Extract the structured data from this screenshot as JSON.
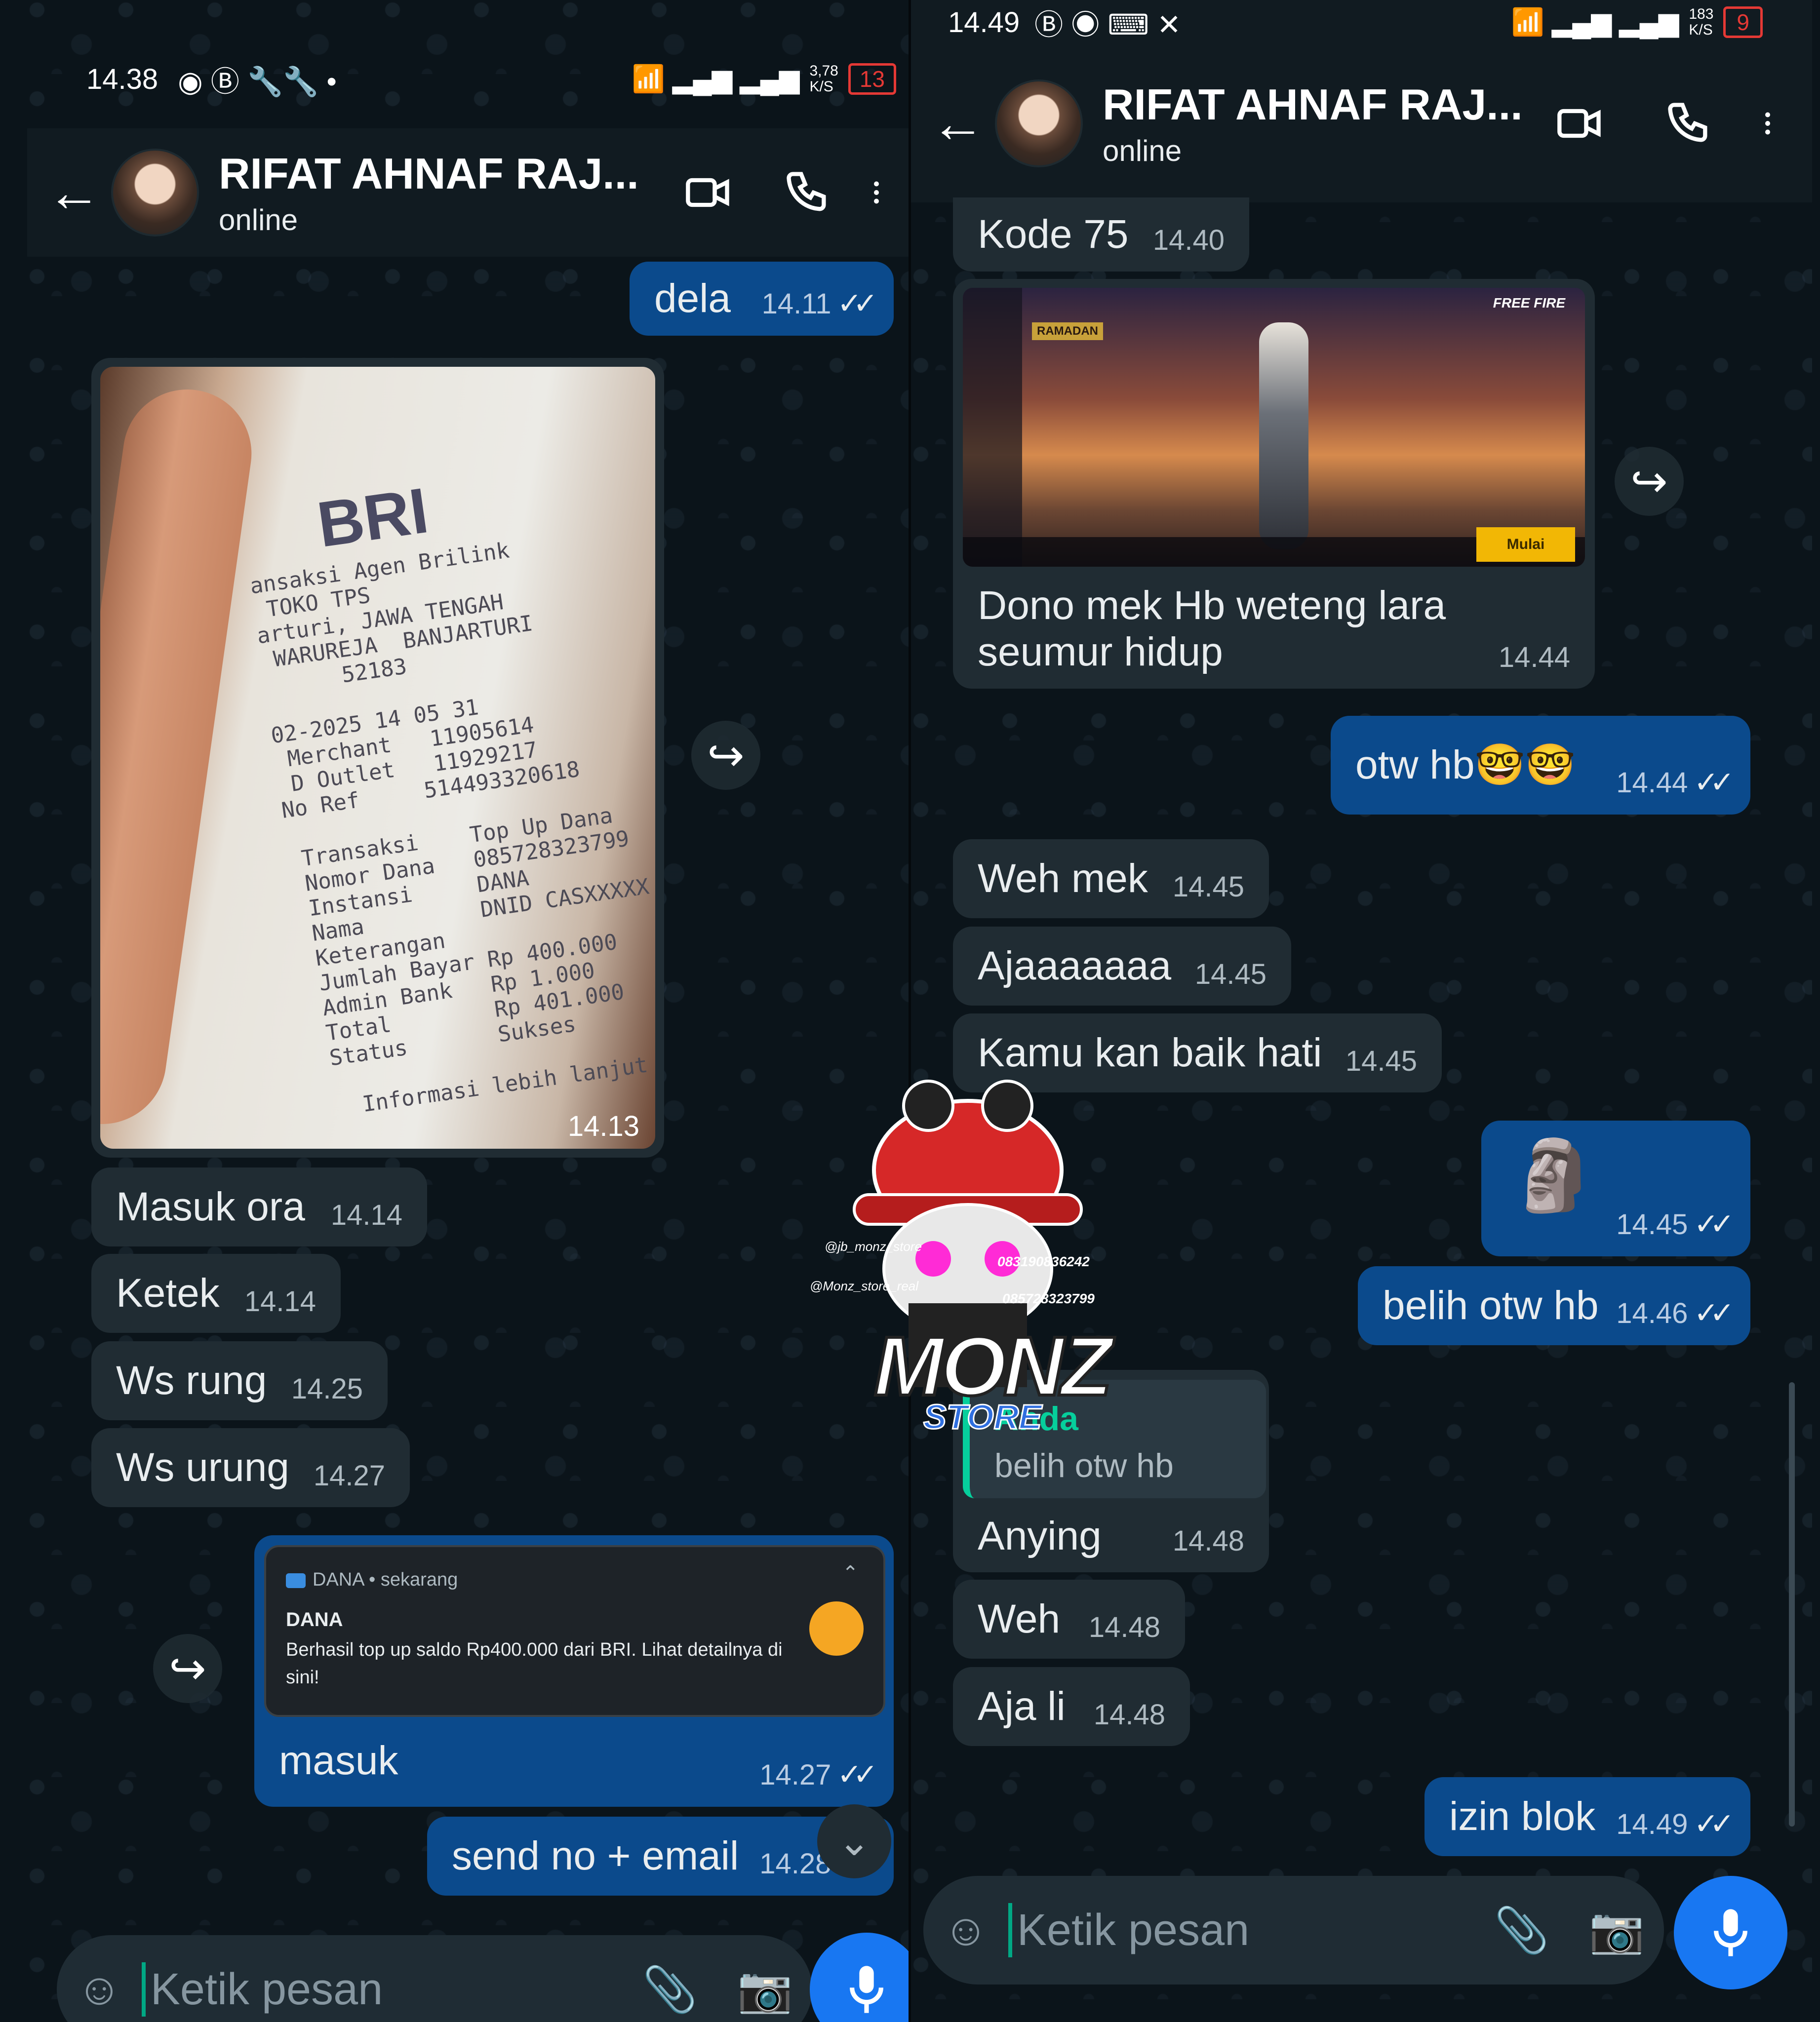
{
  "left": {
    "status": {
      "time": "14.38",
      "net_speed": "3,78\nK/S",
      "battery": "13"
    },
    "header": {
      "name": "RIFAT AHNAF RAJ...",
      "status": "online"
    },
    "messages": {
      "dela": {
        "text": "dela",
        "time": "14.11"
      },
      "photo_time": "14.13",
      "masuk_ora": {
        "text": "Masuk ora",
        "time": "14.14"
      },
      "ketek": {
        "text": "Ketek",
        "time": "14.14"
      },
      "ws_rung": {
        "text": "Ws rung",
        "time": "14.25"
      },
      "ws_urung": {
        "text": "Ws urung",
        "time": "14.27"
      },
      "masuk": {
        "text": "masuk",
        "time": "14.27"
      },
      "send_no": {
        "text": "send no + email",
        "time": "14.28"
      }
    },
    "receipt": {
      "bank": "BRI",
      "lines": "ansaksi Agen Brilink\n TOKO TPS\narturi, JAWA TENGAH\n WARUREJA  BANJARTURI\n      52183\n\n02-2025 14 05 31\n Merchant   11905614\n D Outlet   11929217\nNo Ref     514493320618\n\n Transaksi    Top Up Dana\n Nomor Dana   085728323799\n Instansi     DANA\n Nama         DNID CASXXXXX\n Keterangan\n Jumlah Bayar Rp 400.000\n Admin Bank   Rp 1.000\n Total        Rp 401.000\n Status       Sukses\n\n   Informasi lebih lanjut"
    },
    "notification": {
      "app_line": "DANA • sekarang",
      "title": "DANA",
      "body": "Berhasil top up saldo Rp400.000 dari BRI. Lihat detailnya di sini!"
    },
    "input_placeholder": "Ketik pesan"
  },
  "right": {
    "status": {
      "time": "14.49",
      "net_speed": "183\nK/S",
      "battery": "9"
    },
    "header": {
      "name": "RIFAT AHNAF RAJ...",
      "status": "online"
    },
    "messages": {
      "kode": {
        "text": "Kode 75",
        "time": "14.40"
      },
      "game_caption": {
        "text": "Dono mek Hb weteng lara seumur hidup",
        "time": "14.44"
      },
      "game_labels": {
        "brand": "FREE FIRE",
        "start": "Mulai",
        "event": "RAMADAN"
      },
      "otw": {
        "text": "otw hb🤓🤓",
        "time": "14.44"
      },
      "weh_mek": {
        "text": "Weh mek",
        "time": "14.45"
      },
      "ajaaa": {
        "text": "Ajaaaaaaa",
        "time": "14.45"
      },
      "kamu": {
        "text": "Kamu kan baik hati",
        "time": "14.45"
      },
      "moai": {
        "emoji": "🗿",
        "time": "14.45"
      },
      "belih": {
        "text": "belih otw hb",
        "time": "14.46"
      },
      "reply_quote": {
        "author": "Anda",
        "text": "belih otw hb"
      },
      "anying": {
        "text": "Anying",
        "time": "14.48"
      },
      "weh": {
        "text": "Weh",
        "time": "14.48"
      },
      "aja_li": {
        "text": "Aja li",
        "time": "14.48"
      },
      "izin": {
        "text": "izin blok",
        "time": "14.49"
      }
    },
    "input_placeholder": "Ketik pesan"
  },
  "watermark": {
    "tiktok": "@jb_monz_store",
    "instagram": "@Monz_store_real",
    "phone1": "083190836242",
    "phone2": "085728323799",
    "brand": "MONZ",
    "sub": "STORE"
  },
  "colors": {
    "outgoing": "#0b4a8c",
    "incoming": "#202c33",
    "header": "#111b21",
    "mic": "#1877f2"
  }
}
